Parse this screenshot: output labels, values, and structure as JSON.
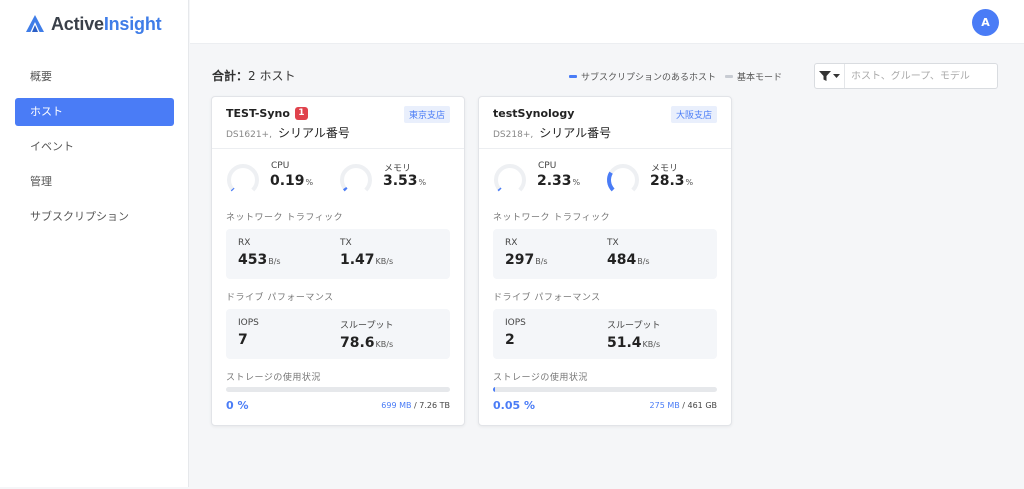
{
  "colors": {
    "accent": "#4a7cf6",
    "gauge_track": "#eef0f3",
    "alert": "#e0424c",
    "legend_basic": "#c8ccd3"
  },
  "logo": {
    "part1": "Active",
    "part2": "Insight"
  },
  "sidebar": {
    "items": [
      {
        "label": "概要",
        "active": false
      },
      {
        "label": "ホスト",
        "active": true
      },
      {
        "label": "イベント",
        "active": false
      },
      {
        "label": "管理",
        "active": false
      },
      {
        "label": "サブスクリプション",
        "active": false
      }
    ]
  },
  "header": {
    "avatar_initial": "A"
  },
  "summary": {
    "prefix": "合計：",
    "count": "2",
    "suffix": " ホスト"
  },
  "legend": {
    "subscription": "サブスクリプションのあるホスト",
    "basic": "基本モード"
  },
  "search": {
    "placeholder": "ホスト、グループ、モデル",
    "value": ""
  },
  "hosts": [
    {
      "name": "TEST-Syno",
      "alert_count": "1",
      "branch": "東京支店",
      "model": "DS1621+,",
      "serial": "シリアル番号",
      "cpu": {
        "label": "CPU",
        "value": "0.19",
        "unit": "%",
        "percent": 0.19
      },
      "memory": {
        "label": "メモリ",
        "value": "3.53",
        "unit": "%",
        "percent": 3.53
      },
      "network_label": "ネットワーク トラフィック",
      "rx": {
        "label": "RX",
        "value": "453",
        "unit": "B/s"
      },
      "tx": {
        "label": "TX",
        "value": "1.47",
        "unit": "KB/s"
      },
      "drive_label": "ドライブ パフォーマンス",
      "iops": {
        "label": "IOPS",
        "value": "7"
      },
      "throughput": {
        "label": "スループット",
        "value": "78.6",
        "unit": "KB/s"
      },
      "storage_label": "ストレージの使用状況",
      "storage_percent_text": "0 %",
      "storage_percent": 0,
      "storage_used": "699 MB",
      "storage_total": " / 7.26 TB"
    },
    {
      "name": "testSynology",
      "alert_count": "",
      "branch": "大阪支店",
      "model": "DS218+,",
      "serial": "シリアル番号",
      "cpu": {
        "label": "CPU",
        "value": "2.33",
        "unit": "%",
        "percent": 2.33
      },
      "memory": {
        "label": "メモリ",
        "value": "28.3",
        "unit": "%",
        "percent": 28.3
      },
      "network_label": "ネットワーク トラフィック",
      "rx": {
        "label": "RX",
        "value": "297",
        "unit": "B/s"
      },
      "tx": {
        "label": "TX",
        "value": "484",
        "unit": "B/s"
      },
      "drive_label": "ドライブ パフォーマンス",
      "iops": {
        "label": "IOPS",
        "value": "2"
      },
      "throughput": {
        "label": "スループット",
        "value": "51.4",
        "unit": "KB/s"
      },
      "storage_label": "ストレージの使用状況",
      "storage_percent_text": "0.05 %",
      "storage_percent": 0.05,
      "storage_used": "275 MB",
      "storage_total": " / 461 GB"
    }
  ]
}
